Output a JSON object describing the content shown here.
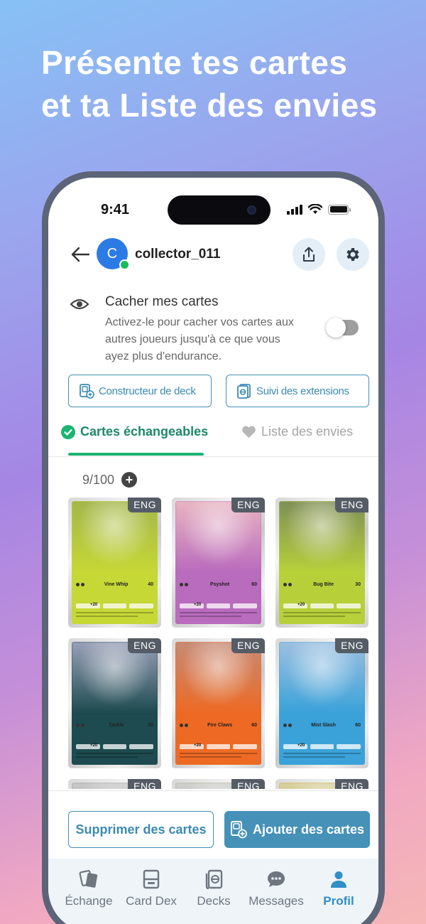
{
  "headline": {
    "line1": "Présente tes cartes",
    "line2": "et ta Liste des envies"
  },
  "status_bar": {
    "time": "9:41"
  },
  "header": {
    "avatar_initial": "C",
    "username": "collector_011"
  },
  "hide_cards": {
    "title": "Cacher mes cartes",
    "description": "Activez-le pour cacher vos cartes aux autres joueurs jusqu'à ce que vous ayez plus d'endurance.",
    "enabled": false
  },
  "actions": {
    "deck_builder": "Constructeur de deck",
    "extensions_tracker": "Suivi des extensions"
  },
  "tabs": {
    "tradable": "Cartes échangeables",
    "wishlist": "Liste des envies",
    "active": "tradable"
  },
  "collection": {
    "count": "9/100"
  },
  "cards": [
    {
      "badge": "ENG",
      "attack": "Vine Whip",
      "damage": "40",
      "retreat": "+20",
      "color": "#c6d836",
      "art": "#a3b64a"
    },
    {
      "badge": "ENG",
      "attack": "Psyshot",
      "damage": "60",
      "retreat": "+20",
      "color": "#b96bbd",
      "art": "#e8b4c0"
    },
    {
      "badge": "ENG",
      "attack": "Bug Bite",
      "damage": "30",
      "retreat": "+20",
      "color": "#b7d03a",
      "art": "#7f8f57"
    },
    {
      "badge": "ENG",
      "attack": "Tackle",
      "damage": "30",
      "retreat": "+20",
      "color": "#1d4b4f",
      "art": "#9aa0b8"
    },
    {
      "badge": "ENG",
      "attack": "Fire Claws",
      "damage": "60",
      "retreat": "+20",
      "color": "#ee6a24",
      "art": "#c68a76"
    },
    {
      "badge": "ENG",
      "attack": "Mist Slash",
      "damage": "60",
      "retreat": "+20",
      "color": "#3aa2d9",
      "art": "#9cbfe0"
    },
    {
      "badge": "ENG",
      "attack": "",
      "damage": "",
      "retreat": "",
      "color": "#9aa0a8",
      "art": "#c7c7c7"
    },
    {
      "badge": "ENG",
      "attack": "",
      "damage": "",
      "retreat": "",
      "color": "#a8b07a",
      "art": "#cfcfcf"
    },
    {
      "badge": "ENG",
      "attack": "",
      "damage": "",
      "retreat": "",
      "color": "#c9b04a",
      "art": "#d8d0a0"
    }
  ],
  "bottom_actions": {
    "remove": "Supprimer des cartes",
    "add": "Ajouter des cartes"
  },
  "nav": [
    {
      "label": "Échange",
      "icon": "cards-exchange-icon",
      "active": false
    },
    {
      "label": "Card Dex",
      "icon": "card-dex-icon",
      "active": false
    },
    {
      "label": "Decks",
      "icon": "deck-icon",
      "active": false
    },
    {
      "label": "Messages",
      "icon": "chat-icon",
      "active": false
    },
    {
      "label": "Profil",
      "icon": "person-icon",
      "active": true
    }
  ],
  "colors": {
    "accent": "#4591b8",
    "active_tab": "#1d8a63",
    "nav_active": "#2f8fc6"
  }
}
